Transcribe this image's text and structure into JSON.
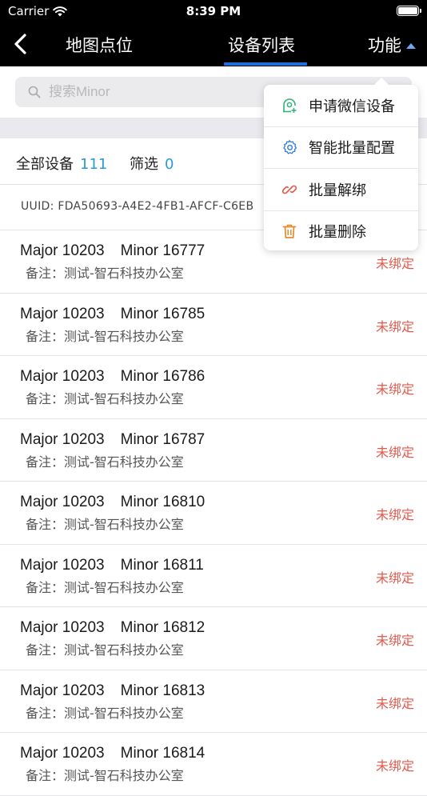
{
  "status_bar": {
    "carrier": "Carrier",
    "time": "8:39 PM"
  },
  "nav": {
    "tabs": [
      {
        "label": "地图点位",
        "active": false
      },
      {
        "label": "设备列表",
        "active": true
      }
    ],
    "function_label": "功能"
  },
  "search": {
    "placeholder": "搜索Minor",
    "value": ""
  },
  "filter": {
    "all_label": "全部设备",
    "all_count": "111",
    "selected_label": "筛选",
    "selected_count": "0"
  },
  "uuid_text": "UUID: FDA50693-A4E2-4FB1-AFCF-C6EB",
  "devices": [
    {
      "major": "Major 10203",
      "minor": "Minor 16777",
      "note": "备注：测试-智石科技办公室",
      "status": "未绑定"
    },
    {
      "major": "Major 10203",
      "minor": "Minor 16785",
      "note": "备注：测试-智石科技办公室",
      "status": "未绑定"
    },
    {
      "major": "Major 10203",
      "minor": "Minor 16786",
      "note": "备注：测试-智石科技办公室",
      "status": "未绑定"
    },
    {
      "major": "Major 10203",
      "minor": "Minor 16787",
      "note": "备注：测试-智石科技办公室",
      "status": "未绑定"
    },
    {
      "major": "Major 10203",
      "minor": "Minor 16810",
      "note": "备注：测试-智石科技办公室",
      "status": "未绑定"
    },
    {
      "major": "Major 10203",
      "minor": "Minor 16811",
      "note": "备注：测试-智石科技办公室",
      "status": "未绑定"
    },
    {
      "major": "Major 10203",
      "minor": "Minor 16812",
      "note": "备注：测试-智石科技办公室",
      "status": "未绑定"
    },
    {
      "major": "Major 10203",
      "minor": "Minor 16813",
      "note": "备注：测试-智石科技办公室",
      "status": "未绑定"
    },
    {
      "major": "Major 10203",
      "minor": "Minor 16814",
      "note": "备注：测试-智石科技办公室",
      "status": "未绑定"
    }
  ],
  "menu": {
    "items": [
      {
        "label": "申请微信设备",
        "icon": "wechat-device-icon",
        "color": "#2fb37a"
      },
      {
        "label": "智能批量配置",
        "icon": "gear-icon",
        "color": "#2e7bdc"
      },
      {
        "label": "批量解绑",
        "icon": "unlink-icon",
        "color": "#e35a4d"
      },
      {
        "label": "批量删除",
        "icon": "trash-icon",
        "color": "#e58a2b"
      }
    ]
  },
  "colors": {
    "accent": "#1e6fd9",
    "count": "#2b9ad6",
    "unbound": "#e35a4d"
  }
}
